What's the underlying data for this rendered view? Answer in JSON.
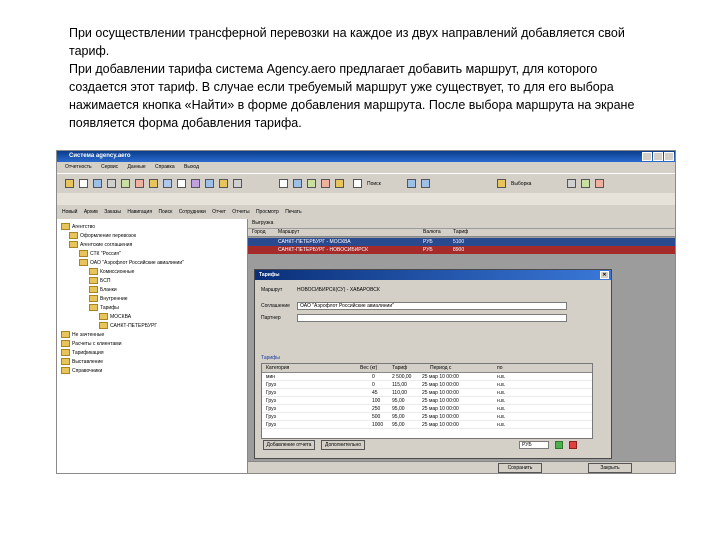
{
  "paragraph": {
    "line1": "При осуществлении трансферной перевозки на каждое из двух направлений добавляется свой",
    "line2": "тариф.",
    "line3": "При добавлении тарифа система Agency.aero предлагает добавить маршрут, для которого",
    "line4": "создается этот тариф. В случае если требуемый маршрут уже существует, то для его выбора",
    "line5": "нажимается кнопка «Найти» в форме добавления маршрута. После выбора маршрута на экране",
    "line6": "появляется форма добавления тарифа."
  },
  "app": {
    "title": "Система agency.aero",
    "menu": [
      "Отчетность",
      "Сервис",
      "Данные",
      "Справка",
      "Выход"
    ],
    "toolbar3": [
      "Новый",
      "Архив",
      "Заказы",
      "Навигация",
      "Поиск",
      "Сотрудники",
      "Отчет",
      "Отчеты",
      "Просмотр",
      "Печать"
    ],
    "search_label": "Поиск",
    "pick_label": "Выборка"
  },
  "tree": {
    "items": [
      "Агентство",
      "Оформление перевозок",
      "Агентские соглашения",
      "СТК \"Россия\"",
      "ОАО \"Аэрофлот Российские авиалинии\"",
      "Комиссионные",
      "БСП",
      "Бланки",
      "Внутренние",
      "Тарифы",
      "МОСКВА",
      "САНКТ-ПЕТЕРБУРГ",
      "Не зачтенные",
      "Расчеты с клиентами",
      "Тарификация",
      "Выставление",
      "Справочники"
    ]
  },
  "route_table": {
    "caption": "Выгрузка",
    "columns": [
      "Город",
      "Маршрут",
      "Валюта",
      "Тариф"
    ],
    "rows": [
      {
        "city": "САНКТ-ПЕТЕРБУРГ - МОСКВА",
        "cur": "РУБ",
        "fare": "5100"
      },
      {
        "city": "САНКТ-ПЕТЕРБУРГ - НОВОСИБИРСК",
        "cur": "РУБ",
        "fare": "8900"
      }
    ]
  },
  "dialog": {
    "title": "Тарифы",
    "route_label": "Маршрут",
    "route_value": "НОВОСИБИРСК(СУ) - ХАБАРОВСК",
    "agreement_label": "Соглашение",
    "agreement_value": "ОАО \"Аэрофлот Российские авиалинии\"",
    "partner_label": "Партнер",
    "grid_caption": "Тарифы",
    "grid_columns": [
      "Категория",
      "Вес (кг)",
      "Тариф",
      "Период с",
      "по"
    ],
    "grid_rows": [
      {
        "cat": "мин",
        "w": "0",
        "fare": "2 500,00",
        "from": "25 мар 10 00:00",
        "to": "н.в."
      },
      {
        "cat": "Груз",
        "w": "0",
        "fare": "115,00",
        "from": "25 мар 10 00:00",
        "to": "н.в."
      },
      {
        "cat": "Груз",
        "w": "45",
        "fare": "110,00",
        "from": "25 мар 10 00:00",
        "to": "н.в."
      },
      {
        "cat": "Груз",
        "w": "100",
        "fare": "95,00",
        "from": "25 мар 10 00:00",
        "to": "н.в."
      },
      {
        "cat": "Груз",
        "w": "250",
        "fare": "95,00",
        "from": "25 мар 10 00:00",
        "to": "н.в."
      },
      {
        "cat": "Груз",
        "w": "500",
        "fare": "95,00",
        "from": "25 мар 10 00:00",
        "to": "н.в."
      },
      {
        "cat": "Груз",
        "w": "1000",
        "fare": "95,00",
        "from": "25 мар 10 00:00",
        "to": "н.в."
      }
    ],
    "add_button": "Добавление отчета",
    "extra_button": "Дополнительно",
    "currency_value": "РУБ",
    "save_button": "Сохранить",
    "close_button": "Закрыть"
  },
  "colors": {
    "title_bar": "#0a3d8a",
    "highlight_row": "#a52a2a",
    "selected_row": "#2a4a90"
  }
}
